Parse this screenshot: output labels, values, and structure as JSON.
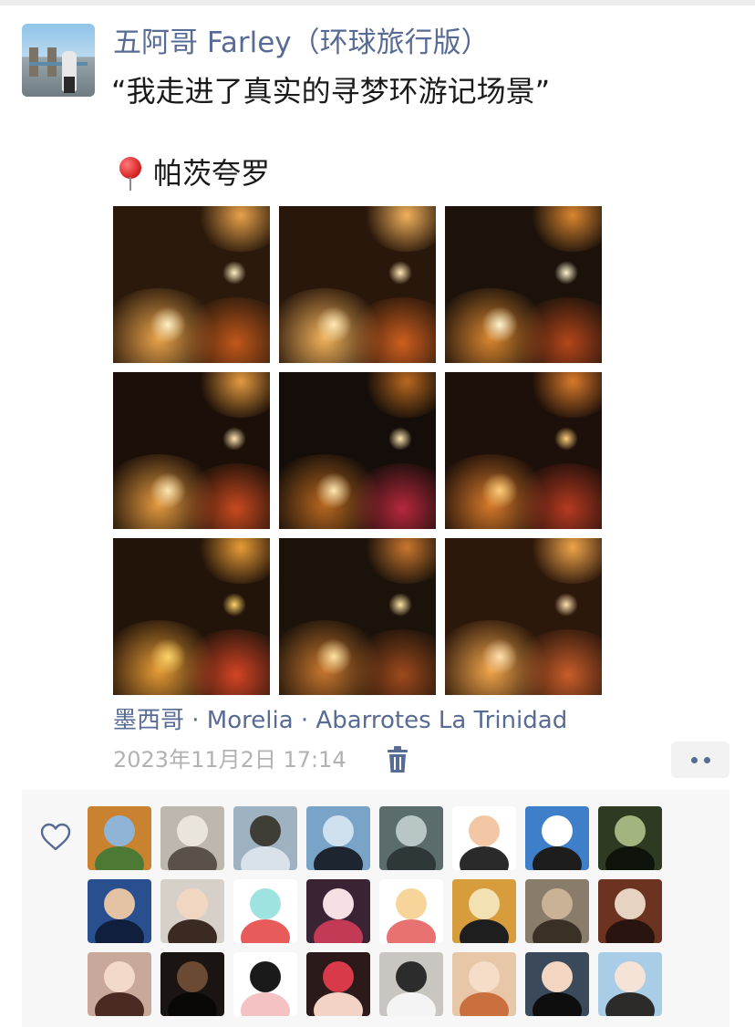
{
  "post": {
    "nickname": "五阿哥 Farley（环球旅行版）",
    "text": "“我走进了真实的寻梦环游记场景”",
    "location_tag": "帕茨夸罗",
    "location": "墨西哥 · Morelia · Abarrotes La Trinidad",
    "timestamp": "2023年11月2日 17:14"
  },
  "icons": {
    "avatar": "avatar-image",
    "pin": "round-pushpin-icon",
    "trash": "trash-icon",
    "more": "more-dots-icon",
    "heart": "heart-outline-icon"
  },
  "colors": {
    "link": "#576b95",
    "meta": "#b2b2b2",
    "text": "#1a1a1a",
    "likes_bg": "#f7f7f7"
  },
  "photos": [
    {
      "bg": "#2b1a0c",
      "c1": "#e8a24a",
      "c2": "#c2571b",
      "c3": "#fff1c4"
    },
    {
      "bg": "#2a170b",
      "c1": "#f0b25b",
      "c2": "#cd5f1e",
      "c3": "#ffe9b5"
    },
    {
      "bg": "#1c120b",
      "c1": "#d9862f",
      "c2": "#b4461a",
      "c3": "#fff4d0"
    },
    {
      "bg": "#1b0f08",
      "c1": "#e49a3f",
      "c2": "#c84a1f",
      "c3": "#ffe6b2"
    },
    {
      "bg": "#140d09",
      "c1": "#b8681f",
      "c2": "#b6283c",
      "c3": "#ffe7b0"
    },
    {
      "bg": "#1d0f09",
      "c1": "#d77a2a",
      "c2": "#b63a21",
      "c3": "#ffcf7a"
    },
    {
      "bg": "#23140a",
      "c1": "#e69b35",
      "c2": "#d44425",
      "c3": "#ffd469"
    },
    {
      "bg": "#1b120a",
      "c1": "#c9772e",
      "c2": "#9e4a1c",
      "c3": "#ffe3a3"
    },
    {
      "bg": "#2c170b",
      "c1": "#f0a54a",
      "c2": "#c85d2a",
      "c3": "#ffe0b0"
    }
  ],
  "likers": [
    {
      "bg": "#c9822f",
      "c1": "#8fb4d6",
      "c2": "#4c7a34"
    },
    {
      "bg": "#bdb7ad",
      "c1": "#e9e4dc",
      "c2": "#5a524a"
    },
    {
      "bg": "#9fb2c2",
      "c1": "#3e3e36",
      "c2": "#d9e2ea"
    },
    {
      "bg": "#7aa3c8",
      "c1": "#cfe0ee",
      "c2": "#1d2630"
    },
    {
      "bg": "#5a6c6c",
      "c1": "#b8c6c6",
      "c2": "#2e3838"
    },
    {
      "bg": "#ffffff",
      "c1": "#f3c7a5",
      "c2": "#2a2a2a"
    },
    {
      "bg": "#3f7ec9",
      "c1": "#ffffff",
      "c2": "#1d1d1d"
    },
    {
      "bg": "#2f3a22",
      "c1": "#a3b57e",
      "c2": "#0e140c"
    },
    {
      "bg": "#2a4f8f",
      "c1": "#e4c3a5",
      "c2": "#0f1f3d"
    },
    {
      "bg": "#d6d0c8",
      "c1": "#f1d7c2",
      "c2": "#3a2a22"
    },
    {
      "bg": "#ffffff",
      "c1": "#9fe3e0",
      "c2": "#e85b5b"
    },
    {
      "bg": "#3a2434",
      "c1": "#f6e0e4",
      "c2": "#c23a55"
    },
    {
      "bg": "#ffffff",
      "c1": "#f7d59a",
      "c2": "#e87171"
    },
    {
      "bg": "#d79c3c",
      "c1": "#f4e1b3",
      "c2": "#1e1e1e"
    },
    {
      "bg": "#8a7c6a",
      "c1": "#c9b295",
      "c2": "#3a3026"
    },
    {
      "bg": "#6c3420",
      "c1": "#e7d3c1",
      "c2": "#2a1410"
    },
    {
      "bg": "#c8a89a",
      "c1": "#f2d9c8",
      "c2": "#4a2a22"
    },
    {
      "bg": "#1a1512",
      "c1": "#6a4a32",
      "c2": "#0a0807"
    },
    {
      "bg": "#ffffff",
      "c1": "#1a1a1a",
      "c2": "#f4c2c2"
    },
    {
      "bg": "#2c1a1a",
      "c1": "#d93a4a",
      "c2": "#f3d3c6"
    },
    {
      "bg": "#c9c6c2",
      "c1": "#2c2c2c",
      "c2": "#f4f4f4"
    },
    {
      "bg": "#e8c7a8",
      "c1": "#f5ddc7",
      "c2": "#c9703e"
    },
    {
      "bg": "#3a4a5a",
      "c1": "#f2d6c2",
      "c2": "#0e0e0e"
    },
    {
      "bg": "#a9cde6",
      "c1": "#f4e3d6",
      "c2": "#2c2b2a"
    }
  ]
}
